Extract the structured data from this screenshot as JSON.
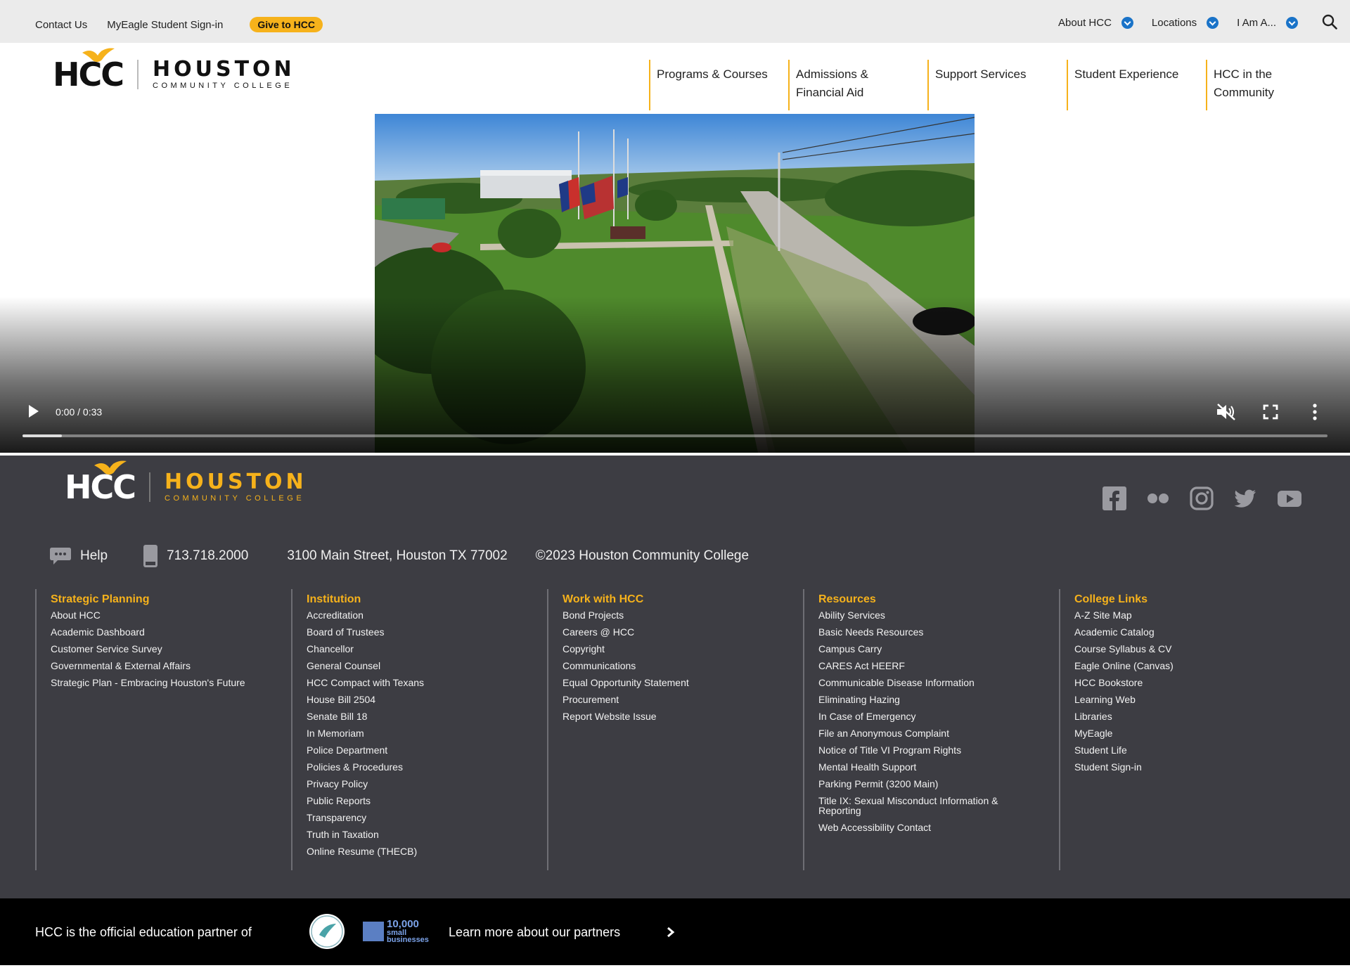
{
  "utility_bar": {
    "contact_us": "Contact Us",
    "myeagle_signin": "MyEagle Student Sign-in",
    "give": "Give to HCC",
    "about": "About HCC",
    "locations": "Locations",
    "i_am": "I Am A...",
    "accent_color": "#f6b21b",
    "chevron_color": "#1a73c8"
  },
  "header": {
    "logo_mark": "HCC",
    "logo_main": "HOUSTON",
    "logo_sub": "COMMUNITY COLLEGE",
    "nav": [
      {
        "line1": "Programs & Courses",
        "line2": ""
      },
      {
        "line1": "Admissions &",
        "line2": "Financial Aid"
      },
      {
        "line1": "Support Services",
        "line2": ""
      },
      {
        "line1": "Student Experience",
        "line2": ""
      },
      {
        "line1": "HCC in the",
        "line2": "Community"
      }
    ]
  },
  "video": {
    "time": "0:00 / 0:33",
    "progress": 0.03,
    "muted": true
  },
  "footer": {
    "logo_mark": "HCC",
    "logo_main": "HOUSTON",
    "logo_sub": "COMMUNITY COLLEGE",
    "social_icons": [
      "facebook-icon",
      "flickr-icon",
      "instagram-icon",
      "twitter-icon",
      "youtube-icon"
    ],
    "help": "Help",
    "phone": "713.718.2000",
    "address": "3100 Main Street, Houston TX 77002",
    "copyright": "©2023 Houston Community College",
    "columns": [
      {
        "heading": "Strategic Planning",
        "links": [
          "About HCC",
          "Academic Dashboard",
          "Customer Service Survey",
          "Governmental & External Affairs",
          "Strategic Plan - Embracing Houston's Future"
        ]
      },
      {
        "heading": "Institution",
        "links": [
          "Accreditation",
          "Board of Trustees",
          "Chancellor",
          "General Counsel",
          "HCC Compact with Texans",
          "House Bill 2504",
          "Senate Bill 18",
          "In Memoriam",
          "Police Department",
          "Policies & Procedures",
          "Privacy Policy",
          "Public Reports",
          "Transparency",
          "Truth in Taxation",
          "Online Resume (THECB)"
        ]
      },
      {
        "heading": "Work with HCC",
        "links": [
          "Bond Projects",
          "Careers @ HCC",
          "Copyright",
          "Communications",
          "Equal Opportunity Statement",
          "Procurement",
          "Report Website Issue"
        ]
      },
      {
        "heading": "Resources",
        "links": [
          "Ability Services",
          "Basic Needs Resources",
          "Campus Carry",
          "CARES Act HEERF",
          "Communicable Disease Information",
          "Eliminating Hazing",
          "In Case of Emergency",
          "File an Anonymous Complaint",
          "Notice of Title VI Program Rights",
          "Mental Health Support",
          "Parking Permit (3200 Main)",
          "Title IX: Sexual Misconduct Information & Reporting",
          "Web Accessibility Contact"
        ]
      },
      {
        "heading": "College Links",
        "links": [
          "A-Z Site Map",
          "Academic Catalog",
          "Course Syllabus & CV",
          "Eagle Online (Canvas)",
          "HCC Bookstore",
          "Learning Web",
          "Libraries",
          "MyEagle",
          "Student Life",
          "Student Sign-in"
        ]
      }
    ]
  },
  "partner_bar": {
    "text": "HCC is the official education partner of",
    "partner_10k_line1": "10,000",
    "partner_10k_line2": "small",
    "partner_10k_line3": "businesses",
    "link": "Learn more about our partners"
  }
}
